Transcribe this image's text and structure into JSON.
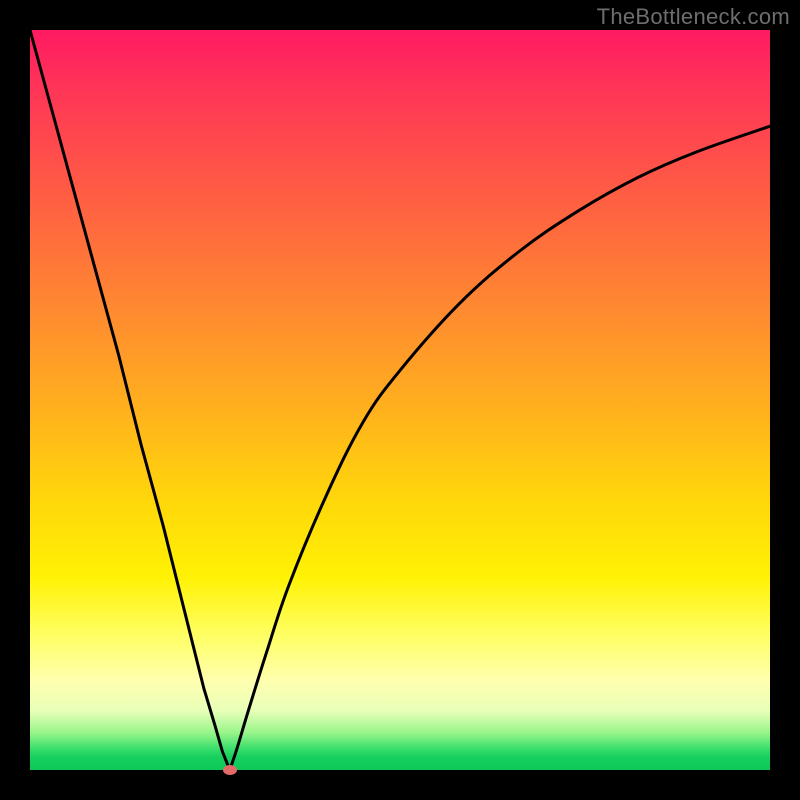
{
  "watermark": "TheBottleneck.com",
  "chart_data": {
    "type": "line",
    "title": "",
    "xlabel": "",
    "ylabel": "",
    "xlim": [
      0,
      100
    ],
    "ylim": [
      0,
      100
    ],
    "grid": false,
    "legend": false,
    "optimum_x": 27,
    "series": [
      {
        "name": "left-branch",
        "x": [
          0,
          3,
          6,
          9,
          12,
          15,
          18,
          20,
          22,
          23.5,
          25,
          26,
          27
        ],
        "values": [
          100,
          89,
          78,
          67,
          56,
          44,
          33,
          25,
          17,
          11,
          6,
          2.5,
          0
        ]
      },
      {
        "name": "right-branch",
        "x": [
          27,
          28,
          29.5,
          32,
          35,
          40,
          45,
          50,
          58,
          66,
          74,
          82,
          90,
          100
        ],
        "values": [
          0,
          3,
          8,
          16,
          25,
          37,
          47,
          54,
          63,
          70,
          75.5,
          80,
          83.5,
          87
        ]
      }
    ],
    "marker": {
      "x": 27,
      "y": 0,
      "color": "#e46a6a"
    },
    "colors": {
      "curve": "#000000",
      "background_top": "#ff1a62",
      "background_bottom": "#0cc858"
    }
  }
}
